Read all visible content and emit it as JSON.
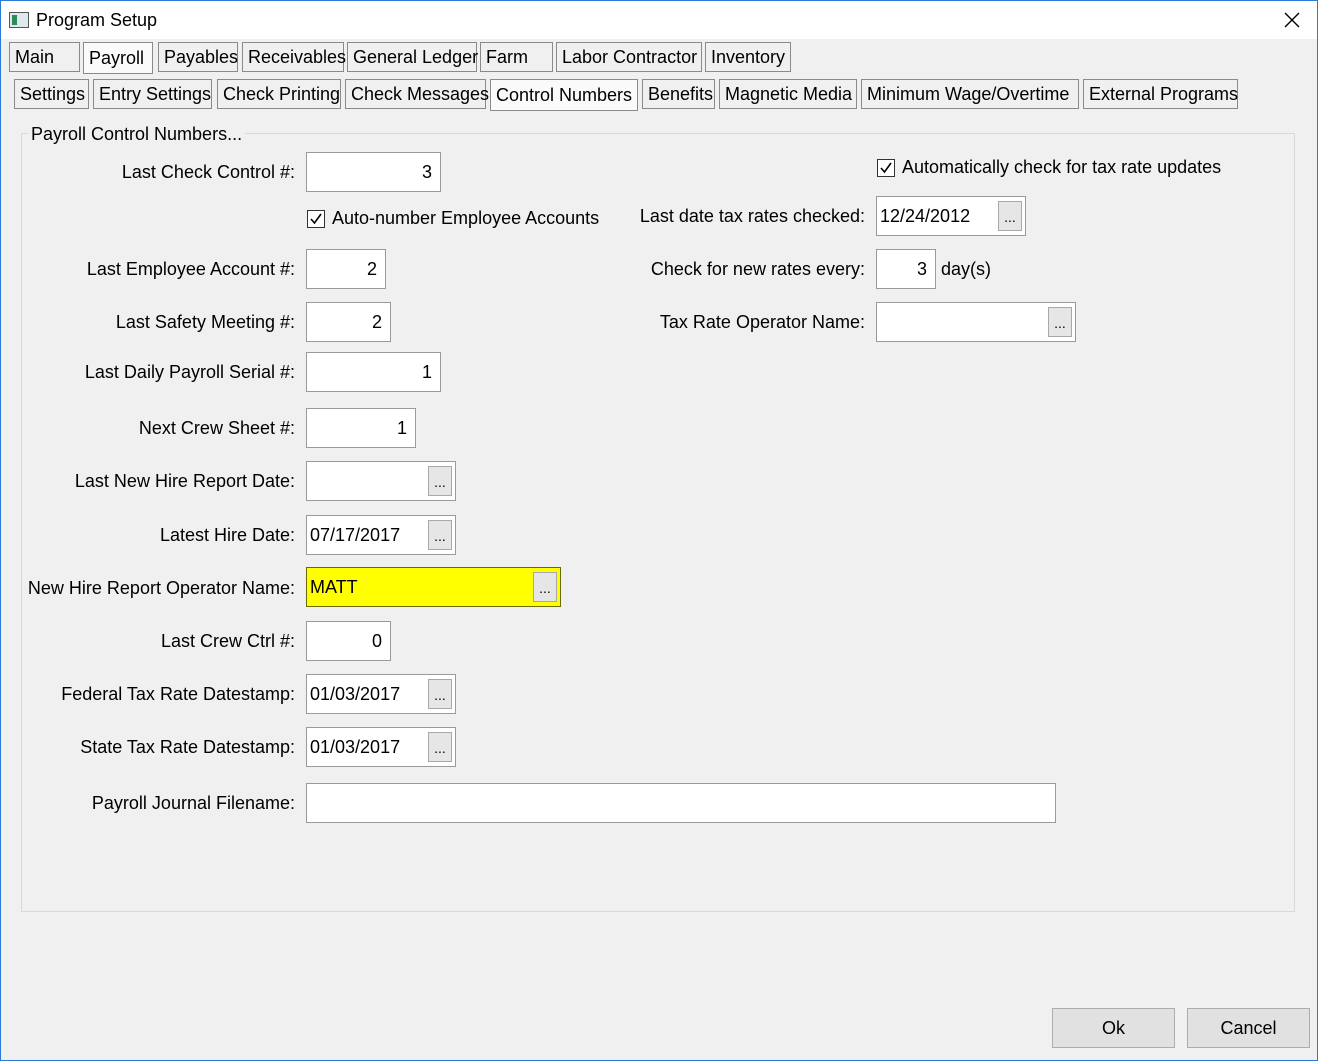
{
  "window": {
    "title": "Program Setup"
  },
  "main_tabs": [
    "Main",
    "Payroll",
    "Payables",
    "Receivables",
    "General Ledger",
    "Farm",
    "Labor Contractor",
    "Inventory"
  ],
  "sub_tabs": [
    "Settings",
    "Entry Settings",
    "Check Printing",
    "Check Messages",
    "Control Numbers",
    "Benefits",
    "Magnetic Media",
    "Minimum Wage/Overtime",
    "External Programs"
  ],
  "group": {
    "title": "Payroll Control Numbers..."
  },
  "fields": {
    "last_check_control": {
      "label": "Last Check Control #:",
      "value": "3"
    },
    "auto_number": {
      "label": "Auto-number Employee Accounts",
      "checked": true
    },
    "last_employee_account": {
      "label": "Last Employee Account #:",
      "value": "2"
    },
    "last_safety_meeting": {
      "label": "Last Safety Meeting #:",
      "value": "2"
    },
    "last_daily_payroll_serial": {
      "label": "Last Daily Payroll Serial #:",
      "value": "1"
    },
    "next_crew_sheet": {
      "label": "Next Crew Sheet #:",
      "value": "1"
    },
    "last_new_hire_report_date": {
      "label": "Last New Hire Report Date:",
      "value": ""
    },
    "latest_hire_date": {
      "label": "Latest Hire Date:",
      "value": "07/17/2017"
    },
    "new_hire_report_operator": {
      "label": "New Hire Report Operator Name:",
      "value": "MATT"
    },
    "last_crew_ctrl": {
      "label": "Last Crew Ctrl #:",
      "value": "0"
    },
    "federal_tax_rate_datestamp": {
      "label": "Federal Tax Rate Datestamp:",
      "value": "01/03/2017"
    },
    "state_tax_rate_datestamp": {
      "label": "State Tax Rate Datestamp:",
      "value": "01/03/2017"
    },
    "payroll_journal_filename": {
      "label": "Payroll Journal Filename:",
      "value": ""
    }
  },
  "tax": {
    "auto_check": {
      "label": "Automatically check for tax rate updates",
      "checked": true
    },
    "last_date_checked": {
      "label": "Last date tax rates checked:",
      "value": "12/24/2012"
    },
    "check_every": {
      "label": "Check for new rates every:",
      "value": "3",
      "unit": "day(s)"
    },
    "operator_name": {
      "label": "Tax Rate Operator Name:",
      "value": ""
    }
  },
  "ellipsis": "...",
  "buttons": {
    "ok": "Ok",
    "cancel": "Cancel"
  },
  "colors": {
    "highlight": "#ffff00",
    "border_accent": "#2b7bd6"
  }
}
